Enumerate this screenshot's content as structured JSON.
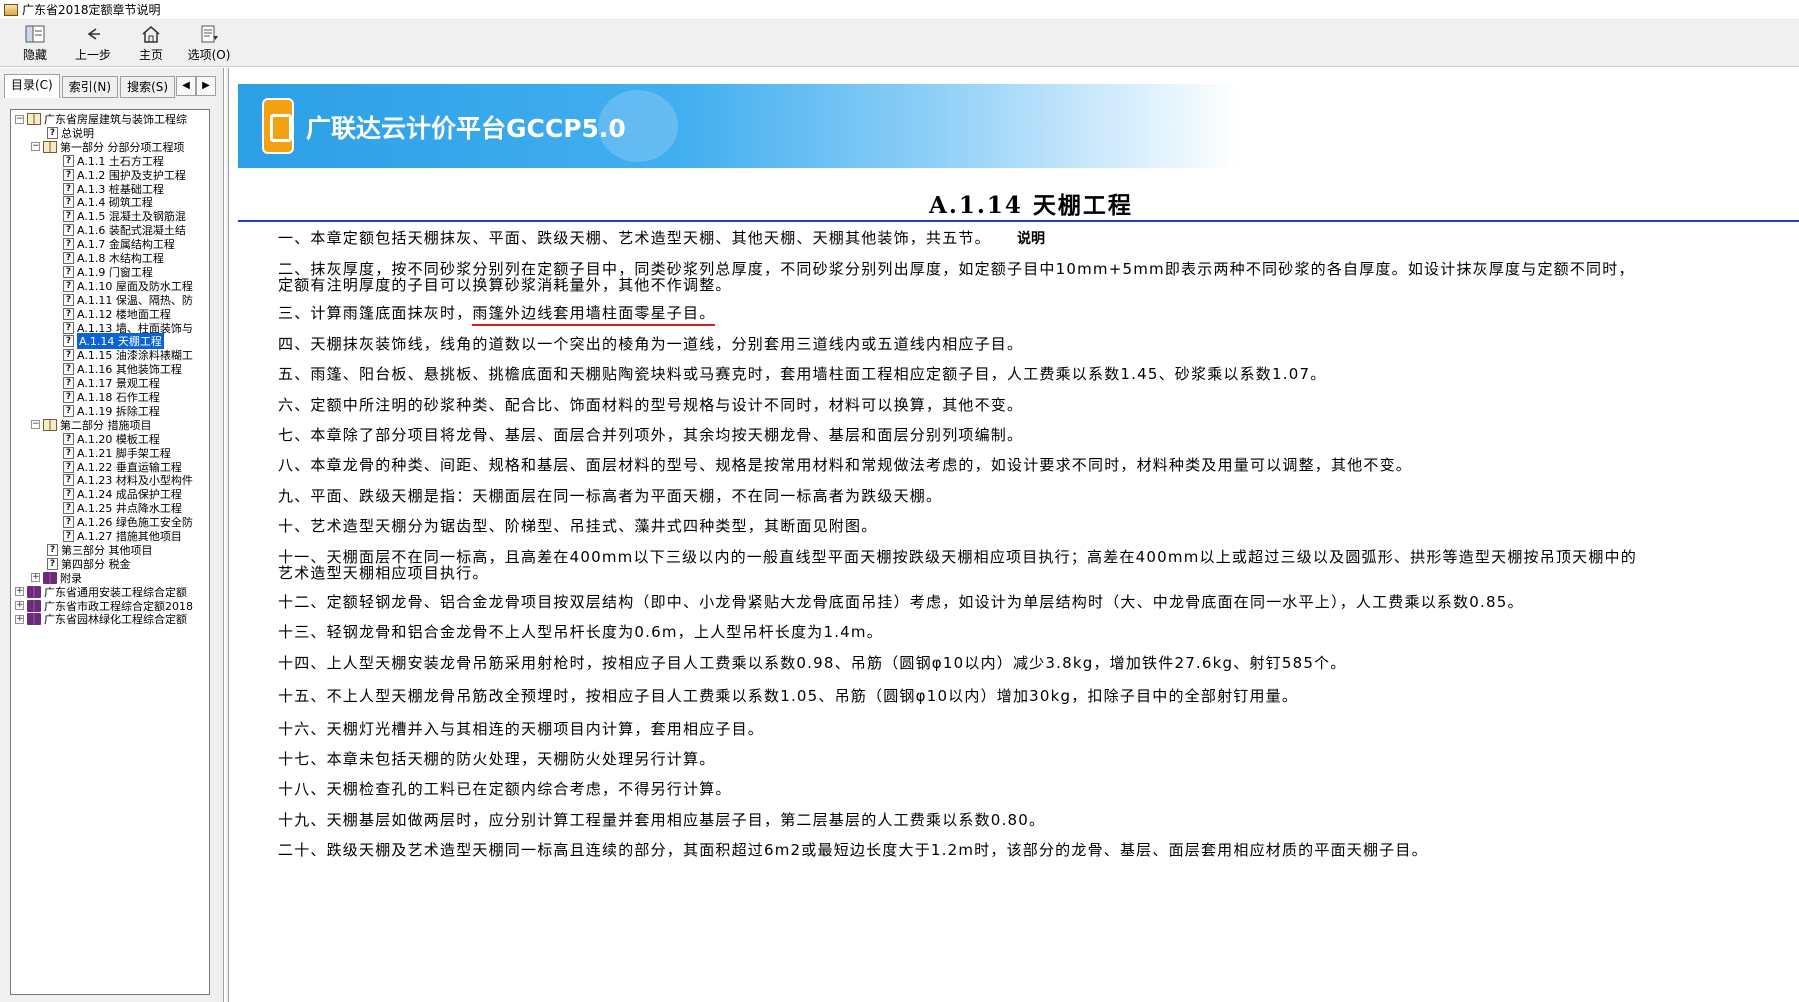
{
  "window": {
    "title": "广东省2018定额章节说明"
  },
  "toolbar": {
    "hide": "隐藏",
    "back": "上一步",
    "home": "主页",
    "options": "选项(O)"
  },
  "tabs": {
    "contents": "目录(C)",
    "index": "索引(N)",
    "search": "搜索(S)"
  },
  "tree": [
    {
      "label": "广东省房屋建筑与装饰工程综",
      "icon": "book-open",
      "expander": "⊟",
      "level": 0
    },
    {
      "label": "总说明",
      "icon": "help-page",
      "level": 2
    },
    {
      "label": "第一部分 分部分项工程项",
      "icon": "book-open",
      "expander": "⊟",
      "level": 1
    },
    {
      "label": "A.1.1 土石方工程",
      "icon": "help-page",
      "level": 3
    },
    {
      "label": "A.1.2 围护及支护工程",
      "icon": "help-page",
      "level": 3
    },
    {
      "label": "A.1.3 桩基础工程",
      "icon": "help-page",
      "level": 3
    },
    {
      "label": "A.1.4 砌筑工程",
      "icon": "help-page",
      "level": 3
    },
    {
      "label": "A.1.5 混凝土及钢筋混",
      "icon": "help-page",
      "level": 3
    },
    {
      "label": "A.1.6 装配式混凝土结",
      "icon": "help-page",
      "level": 3
    },
    {
      "label": "A.1.7 金属结构工程",
      "icon": "help-page",
      "level": 3
    },
    {
      "label": "A.1.8 木结构工程",
      "icon": "help-page",
      "level": 3
    },
    {
      "label": "A.1.9 门窗工程",
      "icon": "help-page",
      "level": 3
    },
    {
      "label": "A.1.10 屋面及防水工程",
      "icon": "help-page",
      "level": 3
    },
    {
      "label": "A.1.11 保温、隔热、防",
      "icon": "help-page",
      "level": 3
    },
    {
      "label": "A.1.12 楼地面工程",
      "icon": "help-page",
      "level": 3
    },
    {
      "label": "A.1.13 墙、柱面装饰与",
      "icon": "help-page",
      "level": 3
    },
    {
      "label": "A.1.14 天棚工程",
      "icon": "help-page",
      "level": 3,
      "selected": true
    },
    {
      "label": "A.1.15 油漆涂料裱糊工",
      "icon": "help-page",
      "level": 3
    },
    {
      "label": "A.1.16 其他装饰工程",
      "icon": "help-page",
      "level": 3
    },
    {
      "label": "A.1.17 景观工程",
      "icon": "help-page",
      "level": 3
    },
    {
      "label": "A.1.18 石作工程",
      "icon": "help-page",
      "level": 3
    },
    {
      "label": "A.1.19 拆除工程",
      "icon": "help-page",
      "level": 3
    },
    {
      "label": "第二部分 措施项目",
      "icon": "book-open",
      "expander": "⊟",
      "level": 1
    },
    {
      "label": "A.1.20 模板工程",
      "icon": "help-page",
      "level": 3
    },
    {
      "label": "A.1.21 脚手架工程",
      "icon": "help-page",
      "level": 3
    },
    {
      "label": "A.1.22 垂直运输工程",
      "icon": "help-page",
      "level": 3
    },
    {
      "label": "A.1.23 材料及小型构件",
      "icon": "help-page",
      "level": 3
    },
    {
      "label": "A.1.24 成品保护工程",
      "icon": "help-page",
      "level": 3
    },
    {
      "label": "A.1.25 井点降水工程",
      "icon": "help-page",
      "level": 3
    },
    {
      "label": "A.1.26 绿色施工安全防",
      "icon": "help-page",
      "level": 3
    },
    {
      "label": "A.1.27 措施其他项目",
      "icon": "help-page",
      "level": 3
    },
    {
      "label": "第三部分 其他项目",
      "icon": "help-page",
      "level": 2
    },
    {
      "label": "第四部分 税金",
      "icon": "help-page",
      "level": 2
    },
    {
      "label": "附录",
      "icon": "book-closed",
      "expander": "⊞",
      "level": 1
    },
    {
      "label": "广东省通用安装工程综合定额",
      "icon": "book-closed",
      "expander": "⊞",
      "level": 0
    },
    {
      "label": "广东省市政工程综合定额2018",
      "icon": "book-closed",
      "expander": "⊞",
      "level": 0
    },
    {
      "label": "广东省园林绿化工程综合定额",
      "icon": "book-closed",
      "expander": "⊞",
      "level": 0
    }
  ],
  "banner": {
    "text": "广联达云计价平台GCCP5.0"
  },
  "content": {
    "heading": "A.1.14 天棚工程",
    "subheading": "说明",
    "paragraphs": [
      {
        "text": "一、本章定额包括天棚抹灰、平面、跌级天棚、艺术造型天棚、其他天棚、天棚其他装饰，共五节。"
      },
      {
        "line1": "二、抹灰厚度，按不同砂浆分别列在定额子目中，同类砂浆列总厚度，不同砂浆分别列出厚度，如定额子目中10mm+5mm即表示两种不同砂浆的各自厚度。如设计抹灰厚度与定额不同时，",
        "line2": "定额有注明厚度的子目可以换算砂浆消耗量外，其他不作调整。"
      },
      {
        "pre": "三、计算雨篷底面抹灰时，",
        "mark": "雨篷外边线套用墙柱面零星子目。"
      },
      {
        "text": "四、天棚抹灰装饰线，线角的道数以一个突出的棱角为一道线，分别套用三道线内或五道线内相应子目。"
      },
      {
        "text": "五、雨篷、阳台板、悬挑板、挑檐底面和天棚贴陶瓷块料或马赛克时，套用墙柱面工程相应定额子目，人工费乘以系数1.45、砂浆乘以系数1.07。"
      },
      {
        "text": "六、定额中所注明的砂浆种类、配合比、饰面材料的型号规格与设计不同时，材料可以换算，其他不变。"
      },
      {
        "text": "七、本章除了部分项目将龙骨、基层、面层合并列项外，其余均按天棚龙骨、基层和面层分别列项编制。"
      },
      {
        "text": "八、本章龙骨的种类、间距、规格和基层、面层材料的型号、规格是按常用材料和常规做法考虑的，如设计要求不同时，材料种类及用量可以调整，其他不变。"
      },
      {
        "text": "九、平面、跌级天棚是指：天棚面层在同一标高者为平面天棚，不在同一标高者为跌级天棚。"
      },
      {
        "text": "十、艺术造型天棚分为锯齿型、阶梯型、吊挂式、藻井式四种类型，其断面见附图。"
      },
      {
        "line1": "十一、天棚面层不在同一标高，且高差在400mm以下三级以内的一般直线型平面天棚按跌级天棚相应项目执行；高差在400mm以上或超过三级以及圆弧形、拱形等造型天棚按吊顶天棚中的",
        "line2": "艺术造型天棚相应项目执行。"
      },
      {
        "text": "十二、定额轻钢龙骨、铝合金龙骨项目按双层结构（即中、小龙骨紧贴大龙骨底面吊挂）考虑，如设计为单层结构时（大、中龙骨底面在同一水平上），人工费乘以系数0.85。"
      },
      {
        "text": "十三、轻钢龙骨和铝合金龙骨不上人型吊杆长度为0.6m，上人型吊杆长度为1.4m。"
      },
      {
        "text": "十四、上人型天棚安装龙骨吊筋采用射枪时，按相应子目人工费乘以系数0.98、吊筋（圆钢φ10以内）减少3.8kg，增加铁件27.6kg、射钉585个。"
      },
      {
        "text": "十五、不上人型天棚龙骨吊筋改全预埋时，按相应子目人工费乘以系数1.05、吊筋（圆钢φ10以内）增加30kg，扣除子目中的全部射钉用量。"
      },
      {
        "text": "十六、天棚灯光槽并入与其相连的天棚项目内计算，套用相应子目。"
      },
      {
        "text": "十七、本章未包括天棚的防火处理，天棚防火处理另行计算。"
      },
      {
        "text": "十八、天棚检查孔的工料已在定额内综合考虑，不得另行计算。"
      },
      {
        "text": "十九、天棚基层如做两层时，应分别计算工程量并套用相应基层子目，第二层基层的人工费乘以系数0.80。"
      },
      {
        "text": "二十、跌级天棚及艺术造型天棚同一标高且连续的部分，其面积超过6m2或最短边长度大于1.2m时，该部分的龙骨、基层、面层套用相应材质的平面天棚子目。"
      }
    ]
  },
  "colors": {
    "rule": "#1f43c8",
    "selection": "#0a64d8",
    "mark": "#e21d1d",
    "banner": "#2c9fe6"
  }
}
